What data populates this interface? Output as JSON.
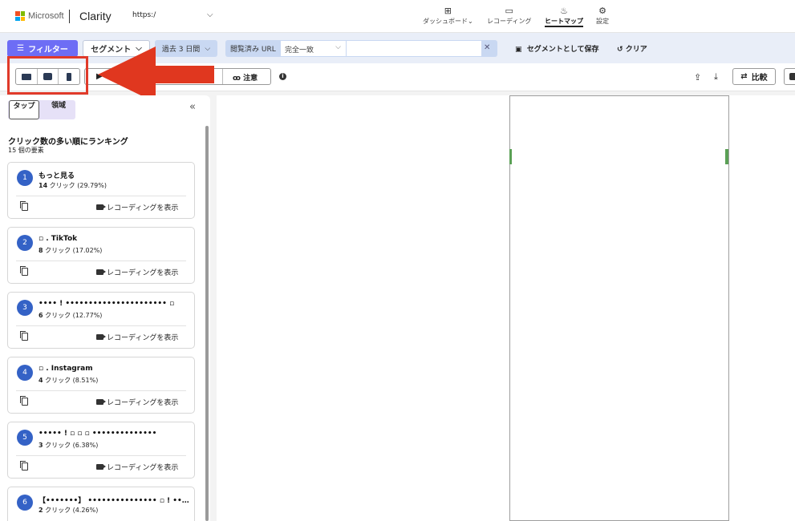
{
  "header": {
    "brand": "Microsoft",
    "product": "Clarity",
    "url": "https:/",
    "nav": [
      {
        "label": "ダッシュボード",
        "icon": "dashboard-icon"
      },
      {
        "label": "レコーディング",
        "icon": "video-camera-icon"
      },
      {
        "label": "ヒートマップ",
        "icon": "flame-icon"
      },
      {
        "label": "設定",
        "icon": "gear-icon"
      }
    ]
  },
  "filterbar": {
    "filter_label": "フィルター",
    "segment_label": "セグメント",
    "date_label": "過去 3 日間",
    "url_filter_label": "閲覧済み URL",
    "url_match_value": "完全一致",
    "url_input_value": "",
    "save_label": "セグメントとして保存",
    "clear_label": "クリア"
  },
  "toolbar": {
    "caution_label": "注意",
    "compare_label": "比較"
  },
  "panel": {
    "tabs": [
      "タップ",
      "領域"
    ],
    "title": "クリック数の多い順にランキング",
    "subtitle": "15 個の要素",
    "view_recording_label": "レコーディングを表示",
    "items": [
      {
        "rank": "1",
        "title": "もっと見る",
        "count": "14",
        "unit": " クリック",
        "pct": " (29.79%)"
      },
      {
        "rank": "2",
        "title": "▫ . TikTok",
        "count": "8",
        "unit": " クリック",
        "pct": " (17.02%)"
      },
      {
        "rank": "3",
        "title": "•••• ! •••••••••••••••••••••• ▫",
        "count": "6",
        "unit": " クリック",
        "pct": " (12.77%)"
      },
      {
        "rank": "4",
        "title": "▫ . Instagram",
        "count": "4",
        "unit": " クリック",
        "pct": " (8.51%)"
      },
      {
        "rank": "5",
        "title": "••••• ! ▫ ▫ ▫ ••••••••••••••",
        "count": "3",
        "unit": " クリック",
        "pct": " (6.38%)"
      },
      {
        "rank": "6",
        "title": "【•••••••】 ••••••••••••••• ▫ ! ••••••••••••• ▫ ▫ ...",
        "count": "2",
        "unit": " クリック",
        "pct": " (4.26%)"
      }
    ]
  },
  "colors": {
    "accent": "#6d6df5",
    "rank_badge": "#3462c6",
    "annotation": "#e03a2a",
    "heat": "#5aa055"
  }
}
